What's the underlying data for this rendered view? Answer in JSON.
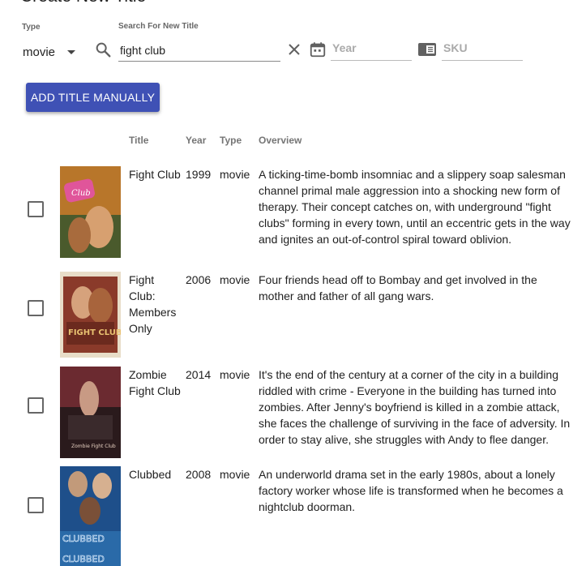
{
  "page": {
    "title": "Create New Title"
  },
  "filters": {
    "type_label": "Type",
    "type_value": "movie",
    "search_label": "Search For New Title",
    "search_value": "fight club",
    "year_placeholder": "Year",
    "sku_placeholder": "SKU"
  },
  "actions": {
    "add_manual_label": "ADD TITLE MANUALLY"
  },
  "table": {
    "headers": {
      "title": "Title",
      "year": "Year",
      "type": "Type",
      "overview": "Overview"
    },
    "rows": [
      {
        "title": "Fight Club",
        "year": "1999",
        "type": "movie",
        "overview": "A ticking-time-bomb insomniac and a slippery soap salesman channel primal male aggression into a shocking new form of therapy. Their concept catches on, with underground \"fight clubs\" forming in every town, until an eccentric gets in the way and ignites an out-of-control spiral toward oblivion."
      },
      {
        "title": "Fight Club: Members Only",
        "year": "2006",
        "type": "movie",
        "overview": "Four friends head off to Bombay and get involved in the mother and father of all gang wars."
      },
      {
        "title": "Zombie Fight Club",
        "year": "2014",
        "type": "movie",
        "overview": "It's the end of the century at a corner of the city in a building riddled with crime - Everyone in the building has turned into zombies. After Jenny's boyfriend is killed in a zombie attack, she faces the challenge of surviving in the face of adversity. In order to stay alive, she struggles with Andy to flee danger."
      },
      {
        "title": "Clubbed",
        "year": "2008",
        "type": "movie",
        "overview": "An underworld drama set in the early 1980s, about a lonely factory worker whose life is transformed when he becomes a nightclub doorman."
      }
    ]
  },
  "posters": [
    {
      "logo_text": "Club",
      "icon": "fight-club-poster"
    },
    {
      "logo_text": "FIGHT CLUB",
      "icon": "fight-club-members-only-poster"
    },
    {
      "logo_text": "Zombie Fight Club",
      "icon": "zombie-fight-club-poster"
    },
    {
      "logo_text": "CLUBBED",
      "icon": "clubbed-poster"
    }
  ],
  "colors": {
    "accent": "#3f51b5",
    "header_text": "#757575",
    "border": "#888888"
  }
}
